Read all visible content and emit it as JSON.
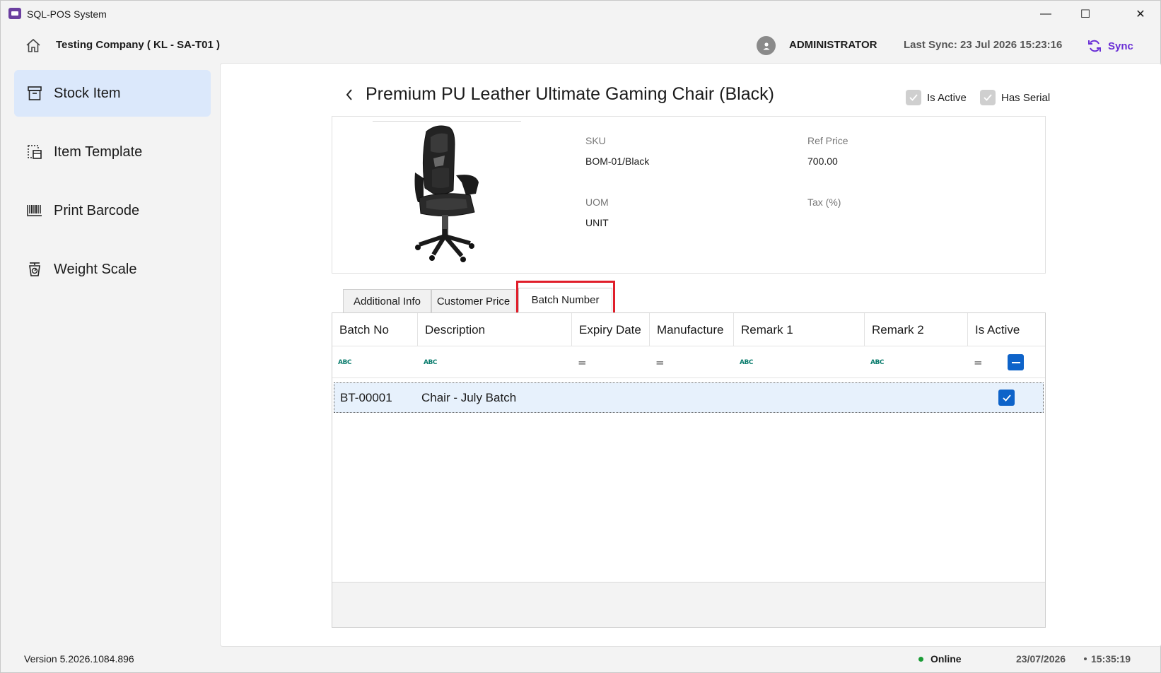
{
  "window": {
    "title": "SQL-POS System",
    "minimize_glyph": "—",
    "maximize_glyph": "☐",
    "close_glyph": "✕"
  },
  "header": {
    "company": "Testing Company ( KL - SA-T01 )",
    "user": "ADMINISTRATOR",
    "last_sync": "Last Sync: 23 Jul 2026 15:23:16",
    "sync_label": "Sync",
    "accent_color": "#6a2fd6"
  },
  "sidebar": {
    "items": [
      {
        "label": "Stock Item",
        "icon": "archive-box-icon",
        "active": true
      },
      {
        "label": "Item Template",
        "icon": "template-icon",
        "active": false
      },
      {
        "label": "Print Barcode",
        "icon": "barcode-icon",
        "active": false
      },
      {
        "label": "Weight Scale",
        "icon": "weight-scale-icon",
        "active": false
      }
    ],
    "active_color": "#dbe8fb"
  },
  "item": {
    "title": "Premium PU Leather Ultimate Gaming Chair (Black)",
    "is_active_label": "Is Active",
    "has_serial_label": "Has Serial",
    "is_active": true,
    "has_serial": true,
    "sku_label": "SKU",
    "sku_value": "BOM-01/Black",
    "ref_price_label": "Ref Price",
    "ref_price_value": "700.00",
    "uom_label": "UOM",
    "uom_value": "UNIT",
    "tax_label": "Tax (%)",
    "tax_value": ""
  },
  "tabs": [
    {
      "label": "Additional Info",
      "active": false
    },
    {
      "label": "Customer Price",
      "active": false
    },
    {
      "label": "Batch Number",
      "active": true
    }
  ],
  "grid": {
    "columns": [
      "Batch No",
      "Description",
      "Expiry Date",
      "Manufacture",
      "Remark 1",
      "Remark 2",
      "Is Active"
    ],
    "filter_icons": [
      "text-filter-icon",
      "text-filter-icon",
      "equals-filter-icon",
      "equals-filter-icon",
      "text-filter-icon",
      "text-filter-icon",
      "equals-filter-icon"
    ],
    "filter_text_glyph": "ABC",
    "filter_equals_glyph": "=",
    "rows": [
      {
        "batch_no": "BT-00001",
        "description": "Chair - July Batch",
        "expiry_date": "",
        "manufacture": "",
        "remark1": "",
        "remark2": "",
        "is_active": true
      }
    ],
    "checkbox_color": "#0e63c9"
  },
  "status": {
    "version": "Version 5.2026.1084.896",
    "connection": "Online",
    "connection_color": "#1a9c36",
    "date": "23/07/2026",
    "time": "15:35:19"
  }
}
